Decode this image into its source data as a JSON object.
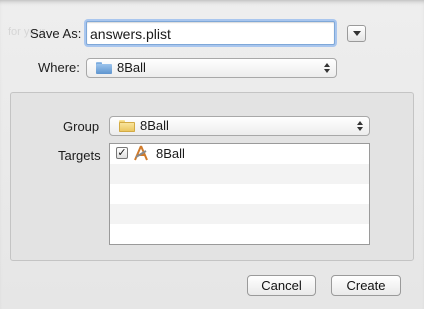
{
  "save_as": {
    "label": "Save As:",
    "value": "answers.plist"
  },
  "options_button": {
    "icon": "chevron-down-icon"
  },
  "where": {
    "label": "Where:",
    "selected": "8Ball",
    "icon": "folder-icon"
  },
  "group": {
    "label": "Group",
    "selected": "8Ball",
    "icon": "folder-icon"
  },
  "targets": {
    "label": "Targets",
    "items": [
      {
        "label": "8Ball",
        "checked": true,
        "icon": "xcode-app-icon"
      }
    ]
  },
  "buttons": {
    "cancel": "Cancel",
    "create": "Create"
  },
  "colors": {
    "accent": "#7fa8d8",
    "folder_blue": "#5f95cf",
    "folder_yellow": "#e9c35a"
  }
}
